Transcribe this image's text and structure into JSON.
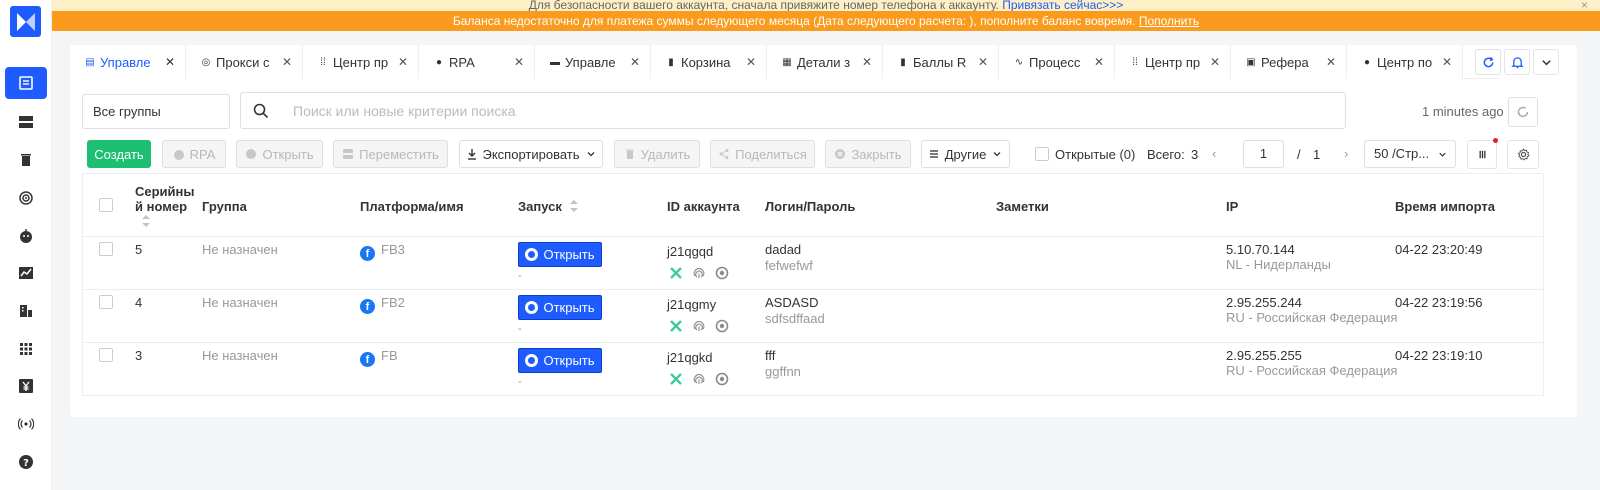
{
  "banners": {
    "security_text": "Для безопасности вашего аккаунта, сначала привяжите номер телефона к аккаунту.",
    "security_link": "Привязать сейчас>>>",
    "security_close": "×",
    "balance_text": "Баланса недостаточно для платежа суммы следующего месяца (Дата следующего расчета: ), пополните баланс вовремя.",
    "balance_link": "Пополнить"
  },
  "tabs": [
    {
      "label": "Управле",
      "icon": "profile-icon",
      "active": true
    },
    {
      "label": "Прокси с",
      "icon": "proxy-icon"
    },
    {
      "label": "Центр пр",
      "icon": "grid-icon"
    },
    {
      "label": "RPA",
      "icon": "rpa-icon"
    },
    {
      "label": "Управле",
      "icon": "server-icon"
    },
    {
      "label": "Корзина",
      "icon": "trash-icon"
    },
    {
      "label": "Детали з",
      "icon": "invoice-icon"
    },
    {
      "label": "Баллы R",
      "icon": "points-icon"
    },
    {
      "label": "Процесс",
      "icon": "activity-icon"
    },
    {
      "label": "Центр пр",
      "icon": "grid-icon"
    },
    {
      "label": "Рефера",
      "icon": "referral-icon"
    },
    {
      "label": "Центр по",
      "icon": "help-icon"
    }
  ],
  "search": {
    "group_select": "Все группы",
    "placeholder": "Поиск или новые критерии поиска",
    "updated_ago": "1 minutes ago"
  },
  "toolbar": {
    "create": "Создать",
    "rpa": "RPA",
    "open": "Открыть",
    "move": "Переместить",
    "export": "Экспортировать",
    "delete": "Удалить",
    "share": "Поделиться",
    "close": "Закрыть",
    "other": "Другие",
    "opened_filter": "Открытые (0)",
    "total_label": "Всего:",
    "total_value": "3",
    "page_current": "1",
    "page_sep": "/",
    "page_total": "1",
    "per_page": "50 /Стр..."
  },
  "table": {
    "headers": {
      "serial": [
        "Серийны",
        "й номер"
      ],
      "group": "Группа",
      "platform": "Платформа/имя",
      "launch": "Запуск",
      "account_id": "ID аккаунта",
      "login": "Логин/Пароль",
      "notes": "Заметки",
      "ip": "IP",
      "import_time": "Время импорта"
    },
    "open_label": "Открыть",
    "rows": [
      {
        "serial": "5",
        "group": "Не назначен",
        "platform": "FB3",
        "launch_sub": "-",
        "account_id": "j21qgqd",
        "login": "dadad",
        "password": "fefwefwf",
        "ip": "5.10.70.144",
        "country": "NL - Нидерланды",
        "time": "04-22 23:20:49"
      },
      {
        "serial": "4",
        "group": "Не назначен",
        "platform": "FB2",
        "launch_sub": "-",
        "account_id": "j21qgmy",
        "login": "ASDASD",
        "password": "sdfsdffaad",
        "ip": "2.95.255.244",
        "country": "RU - Российская Федерация",
        "time": "04-22 23:19:56"
      },
      {
        "serial": "3",
        "group": "Не назначен",
        "platform": "FB",
        "launch_sub": "-",
        "account_id": "j21qgkd",
        "login": "fff",
        "password": "ggffnn",
        "ip": "2.95.255.255",
        "country": "RU - Российская Федерация",
        "time": "04-22 23:19:10"
      }
    ]
  },
  "colors": {
    "primary": "#1f5cff",
    "create": "#1dbf73",
    "warning_banner": "#fa9b1e",
    "info_banner": "#fdf0c6",
    "facebook": "#1877f2"
  }
}
